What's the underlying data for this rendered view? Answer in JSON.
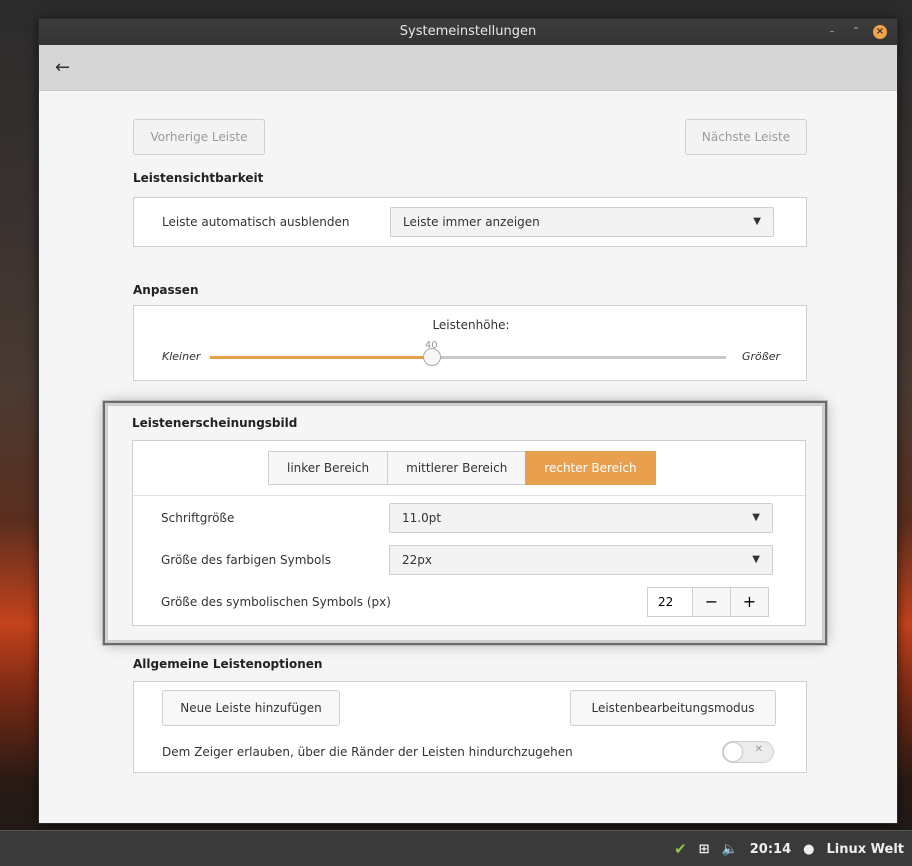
{
  "window": {
    "title": "Systemeinstellungen"
  },
  "nav": {
    "prev_panel": "Vorherige Leiste",
    "next_panel": "Nächste Leiste"
  },
  "visibility": {
    "heading": "Leistensichtbarkeit",
    "label": "Leiste automatisch ausblenden",
    "value": "Leiste immer anzeigen"
  },
  "customize": {
    "heading": "Anpassen",
    "height_label": "Leistenhöhe:",
    "height_value": "40",
    "height_fraction": 0.43,
    "min_label": "Kleiner",
    "max_label": "Größer"
  },
  "appearance": {
    "heading": "Leistenerscheinungsbild",
    "tabs": [
      {
        "label": "linker Bereich",
        "active": false
      },
      {
        "label": "mittlerer Bereich",
        "active": false
      },
      {
        "label": "rechter Bereich",
        "active": true
      }
    ],
    "font_size_label": "Schriftgröße",
    "font_size_value": "11.0pt",
    "color_icon_label": "Größe des farbigen Symbols",
    "color_icon_value": "22px",
    "symbolic_icon_label": "Größe des symbolischen Symbols (px)",
    "symbolic_icon_value": "22",
    "minus": "−",
    "plus": "+"
  },
  "general": {
    "heading": "Allgemeine Leistenoptionen",
    "add_panel": "Neue Leiste hinzufügen",
    "edit_mode": "Leistenbearbeitungsmodus",
    "pointer_label": "Dem Zeiger erlauben, über die Ränder der Leisten hindurchzugehen",
    "pointer_enabled": false
  },
  "taskbar": {
    "time": "20:14",
    "user": "Linux Welt"
  },
  "colors": {
    "accent": "#e8a04e",
    "tray_shield": "#8ec641"
  }
}
